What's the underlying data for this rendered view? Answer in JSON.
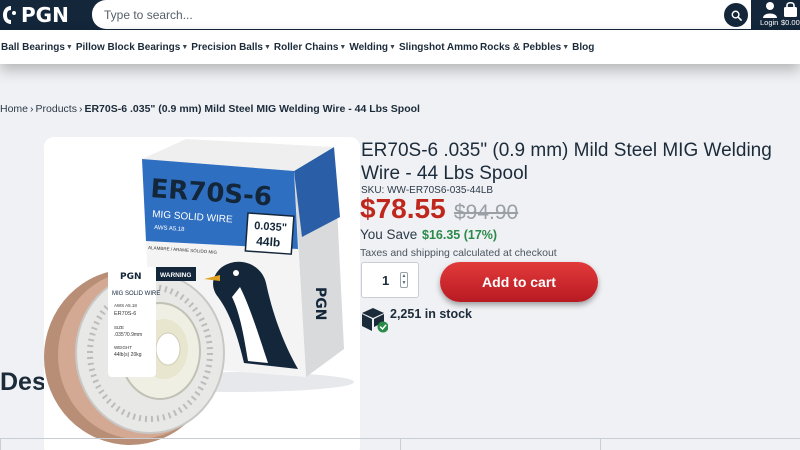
{
  "header": {
    "logo_text": "PGN",
    "search_placeholder": "Type to search...",
    "login_label": "Login",
    "cart_amount": "$0.00"
  },
  "nav": {
    "items": [
      {
        "label": "Ball Bearings",
        "has_dropdown": true
      },
      {
        "label": "Pillow Block Bearings",
        "has_dropdown": true
      },
      {
        "label": "Precision Balls",
        "has_dropdown": true
      },
      {
        "label": "Roller Chains",
        "has_dropdown": true
      },
      {
        "label": "Welding",
        "has_dropdown": true
      },
      {
        "label": "Slingshot Ammo",
        "has_dropdown": false
      },
      {
        "label": "Rocks & Pebbles",
        "has_dropdown": true
      },
      {
        "label": "Blog",
        "has_dropdown": false
      }
    ]
  },
  "breadcrumb": {
    "home": "Home",
    "products": "Products",
    "current": "ER70S-6 .035\" (0.9 mm) Mild Steel MIG Welding Wire - 44 Lbs Spool"
  },
  "product_image": {
    "box_title": "ER70S-6",
    "box_subtitle": "MIG SOLID WIRE",
    "box_standard": "AWS A5.18",
    "box_size": "0.035\"",
    "box_weight": "44lb",
    "box_spanish": "ALAMBRE / ARAME SÓLIDO MIG",
    "brand": "PGN",
    "spool_label": "MIG SOLID WIRE",
    "spool_warning": "WARNING",
    "spool_standard": "AWS A5.18",
    "spool_grade": "ER70S-6",
    "spool_size_label": "SIZE",
    "spool_size": ".035\"/0.9mm",
    "spool_weight_label": "WEIGHT",
    "spool_weight": "44lb(s) 20kg"
  },
  "product": {
    "title": "ER70S-6 .035\" (0.9 mm) Mild Steel MIG Welding Wire - 44 Lbs Spool",
    "sku": "SKU: WW-ER70S6-035-44LB",
    "price": "$78.55",
    "compare_price": "$94.90",
    "you_save_label": "You Save",
    "you_save_amount": "$16.35 (17%)",
    "tax_note": "Taxes and shipping calculated at checkout",
    "quantity": "1",
    "add_to_cart": "Add to cart",
    "stock": "2,251 in stock"
  },
  "description": {
    "heading": "Description"
  },
  "colors": {
    "header_bg": "#13263a",
    "price_red": "#c0271c",
    "save_green": "#2a8a4a",
    "cart_button": "#c8222a",
    "box_blue": "#2f6fc1"
  },
  "icons": [
    "search-icon",
    "user-icon",
    "cart-icon",
    "chevron-down-icon",
    "box-stock-icon",
    "check-icon"
  ]
}
